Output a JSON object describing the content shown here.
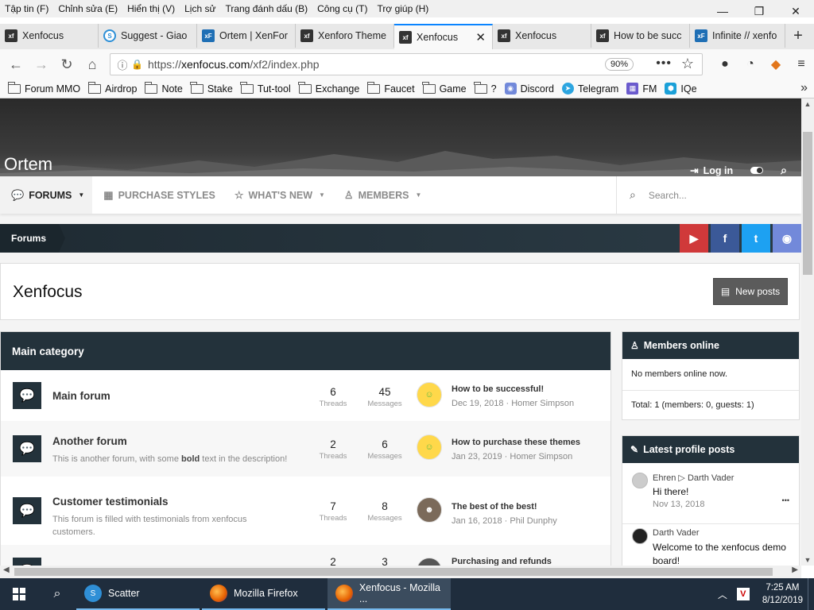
{
  "menubar": {
    "items": [
      "Tập tin (F)",
      "Chỉnh sửa (E)",
      "Hiển thị (V)",
      "Lịch sử",
      "Trang đánh dấu (B)",
      "Công cụ (T)",
      "Trợ giúp (H)"
    ]
  },
  "window": {
    "minimize": "—",
    "restore": "❐",
    "close": "✕"
  },
  "tabs": [
    {
      "label": "Xenfocus",
      "favicon": "xf",
      "active": false
    },
    {
      "label": "Suggest - Giao",
      "favicon": "S",
      "active": false
    },
    {
      "label": "Ortem | XenFor",
      "favicon": "xF",
      "active": false
    },
    {
      "label": "Xenforo Theme",
      "favicon": "xf",
      "active": false
    },
    {
      "label": "Xenfocus",
      "favicon": "xf",
      "active": true
    },
    {
      "label": "Xenfocus",
      "favicon": "xf",
      "active": false
    },
    {
      "label": "How to be succ",
      "favicon": "xf",
      "active": false
    },
    {
      "label": "Infinite // xenfo",
      "favicon": "xF",
      "active": false
    }
  ],
  "tab_close": "✕",
  "new_tab": "+",
  "nav": {
    "url_prefix": "https://",
    "url_host": "xenfocus.com",
    "url_path": "/xf2/index.php",
    "zoom": "90%"
  },
  "bookmarks": [
    {
      "label": "Forum MMO",
      "type": "folder"
    },
    {
      "label": "Airdrop",
      "type": "folder"
    },
    {
      "label": "Note",
      "type": "folder"
    },
    {
      "label": "Stake",
      "type": "folder"
    },
    {
      "label": "Tut-tool",
      "type": "folder"
    },
    {
      "label": "Exchange",
      "type": "folder"
    },
    {
      "label": "Faucet",
      "type": "folder"
    },
    {
      "label": "Game",
      "type": "folder"
    },
    {
      "label": "?",
      "type": "folder"
    },
    {
      "label": "Discord",
      "type": "discord"
    },
    {
      "label": "Telegram",
      "type": "telegram"
    },
    {
      "label": "FM",
      "type": "grid"
    },
    {
      "label": "IQe",
      "type": "iqe"
    }
  ],
  "site": {
    "title": "Ortem",
    "login": "Log in"
  },
  "mainnav": [
    {
      "label": "FORUMS",
      "icon": "comments-icon",
      "caret": true,
      "active": true
    },
    {
      "label": "PURCHASE STYLES",
      "icon": "grid-icon",
      "caret": false,
      "active": false
    },
    {
      "label": "WHAT'S NEW",
      "icon": "star-icon",
      "caret": true,
      "active": false
    },
    {
      "label": "MEMBERS",
      "icon": "user-icon",
      "caret": true,
      "active": false
    }
  ],
  "search": {
    "placeholder": "Search..."
  },
  "breadcrumb": "Forums",
  "social": [
    {
      "name": "youtube",
      "glyph": "▶",
      "color": "#d0393a"
    },
    {
      "name": "facebook",
      "glyph": "f",
      "color": "#3b5998"
    },
    {
      "name": "twitter",
      "glyph": "t",
      "color": "#1da1f2"
    },
    {
      "name": "discord",
      "glyph": "◉",
      "color": "#7289da"
    }
  ],
  "page": {
    "title": "Xenfocus",
    "new_posts": "New posts"
  },
  "category": {
    "title": "Main category",
    "forums": [
      {
        "name": "Main forum",
        "desc_pre": "",
        "desc_bold": "",
        "desc_post": "",
        "threads": "6",
        "threads_label": "Threads",
        "messages": "45",
        "messages_label": "Messages",
        "last_title": "How to be successful!",
        "last_meta": "Dec 19, 2018 · Homer Simpson",
        "avatar": "homer"
      },
      {
        "name": "Another forum",
        "desc_pre": "This is another forum, with some ",
        "desc_bold": "bold",
        "desc_post": " text in the description!",
        "threads": "2",
        "threads_label": "Threads",
        "messages": "6",
        "messages_label": "Messages",
        "last_title": "How to purchase these themes",
        "last_meta": "Jan 23, 2019 · Homer Simpson",
        "avatar": "homer"
      },
      {
        "name": "Customer testimonials",
        "desc_pre": "This forum is filled with testimonials from xenfocus customers.",
        "desc_bold": "",
        "desc_post": "",
        "threads": "7",
        "threads_label": "Threads",
        "messages": "8",
        "messages_label": "Messages",
        "last_title": "The best of the best!",
        "last_meta": "Jan 16, 2018 · Phil Dunphy",
        "avatar": "phil"
      },
      {
        "name": "",
        "desc_pre": "",
        "desc_bold": "",
        "desc_post": "",
        "threads": "2",
        "threads_label": "",
        "messages": "3",
        "messages_label": "",
        "last_title": "Purchasing and refunds",
        "last_meta": "",
        "avatar": "dark"
      }
    ]
  },
  "members_online": {
    "title": "Members online",
    "status": "No members online now.",
    "total": "Total: 1 (members: 0, guests: 1)"
  },
  "profile_posts": {
    "title": "Latest profile posts",
    "posts": [
      {
        "from": "Ehren",
        "arrow": "▷",
        "to": "Darth Vader",
        "message": "Hi there!",
        "date": "Nov 13, 2018",
        "more": "•••"
      },
      {
        "from": "Darth Vader",
        "arrow": "",
        "to": "",
        "message": "Welcome to the xenfocus demo board!",
        "date": "",
        "more": ""
      }
    ]
  },
  "taskbar": {
    "tasks": [
      {
        "label": "Scatter",
        "active": false,
        "color": "#2f8fd6"
      },
      {
        "label": "Mozilla Firefox",
        "active": false,
        "color": "#e66000"
      },
      {
        "label": "Xenfocus - Mozilla ...",
        "active": true,
        "color": "#e66000"
      }
    ],
    "time": "7:25 AM",
    "date": "8/12/2019"
  }
}
